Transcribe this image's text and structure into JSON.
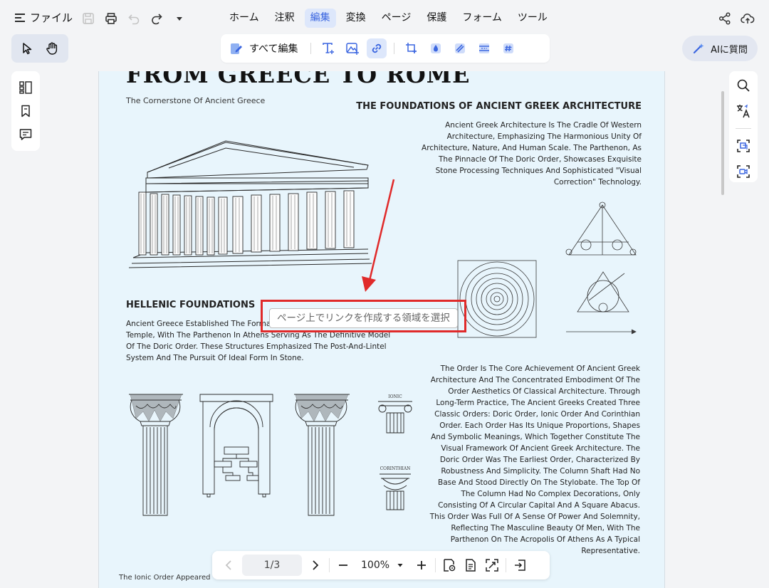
{
  "menu": {
    "file_label": "ファイル",
    "tabs": [
      {
        "label": "ホーム"
      },
      {
        "label": "注釈"
      },
      {
        "label": "編集",
        "active": true
      },
      {
        "label": "変換"
      },
      {
        "label": "ページ"
      },
      {
        "label": "保護"
      },
      {
        "label": "フォーム"
      },
      {
        "label": "ツール"
      }
    ]
  },
  "edit_toolbar": {
    "edit_all_label": "すべて編集"
  },
  "ai": {
    "label": "AIに質問"
  },
  "document": {
    "title": "FROM GREECE TO ROME",
    "subtitle": "The Cornerstone Of Ancient Greece",
    "section_right_title": "THE FOUNDATIONS OF ANCIENT GREEK ARCHITECTURE",
    "section_right_paragraph": "Ancient Greek Architecture Is The Cradle Of Western Architecture, Emphasizing The Harmonious Unity Of Architecture, Nature, And Human Scale. The Parthenon, As The Pinnacle Of The Doric Order, Showcases Exquisite Stone Processing Techniques And Sophisticated \"Visual Correction\" Technology.",
    "section_left_title": "HELLENIC FOUNDATIONS",
    "section_left_paragraph": "Ancient Greece Established The Formal Architecture Through The Temple, With The Parthenon In Athens Serving As The Definitive Model Of The Doric Order. These Structures Emphasized The Post-And-Lintel System And The Pursuit Of Ideal Form In Stone.",
    "orders_paragraph": "The Order Is The Core Achievement Of Ancient Greek Architecture And The Concentrated Embodiment Of The Order Aesthetics Of Classical Architecture. Through Long-Term Practice, The Ancient Greeks Created Three Classic Orders: Doric Order, Ionic Order And Corinthian Order. Each Order Has Its Unique Proportions, Shapes And Symbolic Meanings, Which Together Constitute The Visual Framework Of Ancient Greek Architecture. The Doric Order Was The Earliest Order, Characterized By Robustness And Simplicity. The Column Shaft Had No Base And Stood Directly On The Stylobate. The Top Of The Column Had No Complex Decorations, Only Consisting Of A Circular Capital And A Square Abacus. This Order Was Full Of A Sense Of Power And Solemnity, Reflecting The Masculine Beauty Of Men, With The Parthenon On The Acropolis Of Athens As A Typical Representative.",
    "cut_text": "The Ionic Order Appeared",
    "ionic_caption": "IONIC",
    "corinthian_caption": "CORINTHIAN"
  },
  "selection_tooltip": "ページ上でリンクを作成する領域を選択",
  "navigation": {
    "page_indicator": "1/3",
    "zoom": "100%"
  },
  "colors": {
    "accent": "#3b66e0",
    "active_tab_bg": "#dde7fb",
    "page_bg": "#e8f5fc",
    "annotation_red": "#e02a2a"
  }
}
